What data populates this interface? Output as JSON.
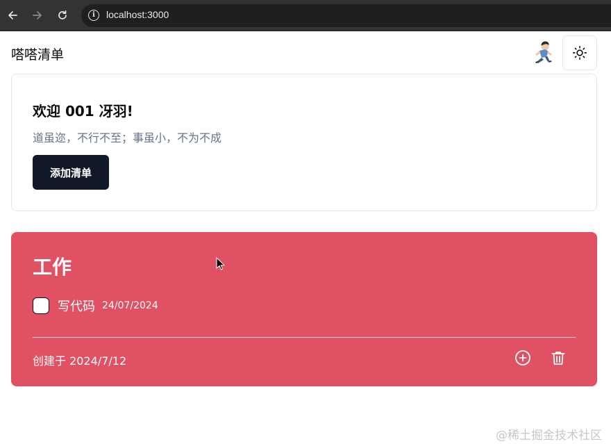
{
  "browser": {
    "url": "localhost:3000"
  },
  "app": {
    "title": "嗒嗒清单"
  },
  "welcome": {
    "title": "欢迎 001 冴羽!",
    "subtitle": "道虽迩，不行不至；事虽小，不为不成",
    "add_button": "添加清单"
  },
  "list": {
    "title": "工作",
    "color": "#e05163",
    "items": [
      {
        "text": "写代码",
        "date": "24/07/2024",
        "checked": false
      }
    ],
    "created": "创建于 2024/7/12"
  },
  "watermark": "@稀土掘金技术社区",
  "icons": {
    "back": "arrow-left-icon",
    "forward": "arrow-right-icon",
    "reload": "reload-icon",
    "info": "info-icon",
    "theme": "sun-icon",
    "add": "plus-circle-icon",
    "delete": "trash-icon"
  }
}
